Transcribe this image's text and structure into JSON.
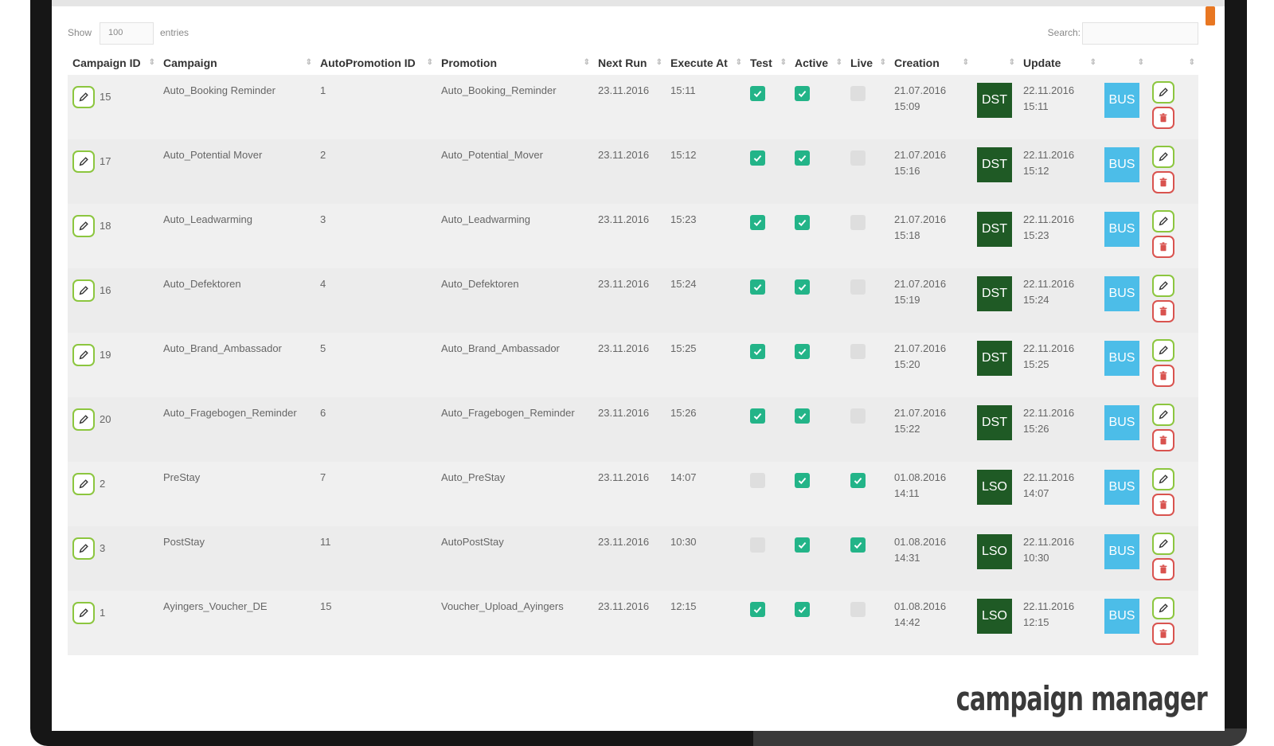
{
  "controls": {
    "show_label": "Show",
    "entries_value": "100",
    "entries_label": "entries",
    "search_label": "Search:"
  },
  "columns": [
    "Campaign ID",
    "Campaign",
    "AutoPromotion ID",
    "Promotion",
    "Next Run",
    "Execute At",
    "Test",
    "Active",
    "Live",
    "Creation",
    "",
    "Update",
    "",
    ""
  ],
  "rows": [
    {
      "campaign_id": "15",
      "campaign": "Auto_Booking Reminder",
      "autopromotion_id": "1",
      "promotion": "Auto_Booking_Reminder",
      "next_run": "23.11.2016",
      "execute_at": "15:11",
      "test": true,
      "active": true,
      "live": false,
      "creation_date": "21.07.2016",
      "creation_time": "15:09",
      "type": "DST",
      "update_date": "22.11.2016",
      "update_time": "15:11",
      "bus": "BUS"
    },
    {
      "campaign_id": "17",
      "campaign": "Auto_Potential Mover",
      "autopromotion_id": "2",
      "promotion": "Auto_Potential_Mover",
      "next_run": "23.11.2016",
      "execute_at": "15:12",
      "test": true,
      "active": true,
      "live": false,
      "creation_date": "21.07.2016",
      "creation_time": "15:16",
      "type": "DST",
      "update_date": "22.11.2016",
      "update_time": "15:12",
      "bus": "BUS"
    },
    {
      "campaign_id": "18",
      "campaign": "Auto_Leadwarming",
      "autopromotion_id": "3",
      "promotion": "Auto_Leadwarming",
      "next_run": "23.11.2016",
      "execute_at": "15:23",
      "test": true,
      "active": true,
      "live": false,
      "creation_date": "21.07.2016",
      "creation_time": "15:18",
      "type": "DST",
      "update_date": "22.11.2016",
      "update_time": "15:23",
      "bus": "BUS"
    },
    {
      "campaign_id": "16",
      "campaign": "Auto_Defektoren",
      "autopromotion_id": "4",
      "promotion": "Auto_Defektoren",
      "next_run": "23.11.2016",
      "execute_at": "15:24",
      "test": true,
      "active": true,
      "live": false,
      "creation_date": "21.07.2016",
      "creation_time": "15:19",
      "type": "DST",
      "update_date": "22.11.2016",
      "update_time": "15:24",
      "bus": "BUS"
    },
    {
      "campaign_id": "19",
      "campaign": "Auto_Brand_Ambassador",
      "autopromotion_id": "5",
      "promotion": "Auto_Brand_Ambassador",
      "next_run": "23.11.2016",
      "execute_at": "15:25",
      "test": true,
      "active": true,
      "live": false,
      "creation_date": "21.07.2016",
      "creation_time": "15:20",
      "type": "DST",
      "update_date": "22.11.2016",
      "update_time": "15:25",
      "bus": "BUS"
    },
    {
      "campaign_id": "20",
      "campaign": "Auto_Fragebogen_Reminder",
      "autopromotion_id": "6",
      "promotion": "Auto_Fragebogen_Reminder",
      "next_run": "23.11.2016",
      "execute_at": "15:26",
      "test": true,
      "active": true,
      "live": false,
      "creation_date": "21.07.2016",
      "creation_time": "15:22",
      "type": "DST",
      "update_date": "22.11.2016",
      "update_time": "15:26",
      "bus": "BUS"
    },
    {
      "campaign_id": "2",
      "campaign": "PreStay",
      "autopromotion_id": "7",
      "promotion": "Auto_PreStay",
      "next_run": "23.11.2016",
      "execute_at": "14:07",
      "test": false,
      "active": true,
      "live": true,
      "creation_date": "01.08.2016",
      "creation_time": "14:11",
      "type": "LSO",
      "update_date": "22.11.2016",
      "update_time": "14:07",
      "bus": "BUS"
    },
    {
      "campaign_id": "3",
      "campaign": "PostStay",
      "autopromotion_id": "11",
      "promotion": "AutoPostStay",
      "next_run": "23.11.2016",
      "execute_at": "10:30",
      "test": false,
      "active": true,
      "live": true,
      "creation_date": "01.08.2016",
      "creation_time": "14:31",
      "type": "LSO",
      "update_date": "22.11.2016",
      "update_time": "10:30",
      "bus": "BUS"
    },
    {
      "campaign_id": "1",
      "campaign": "Ayingers_Voucher_DE",
      "autopromotion_id": "15",
      "promotion": "Voucher_Upload_Ayingers",
      "next_run": "23.11.2016",
      "execute_at": "12:15",
      "test": true,
      "active": true,
      "live": false,
      "creation_date": "01.08.2016",
      "creation_time": "14:42",
      "type": "LSO",
      "update_date": "22.11.2016",
      "update_time": "12:15",
      "bus": "BUS"
    }
  ],
  "brand": "campaign manager",
  "colors": {
    "check_on": "#23b488",
    "badge_dark": "#1f5a25",
    "badge_blue": "#4cbde8",
    "edit_border": "#8cc63f",
    "delete_border": "#d9534f"
  }
}
